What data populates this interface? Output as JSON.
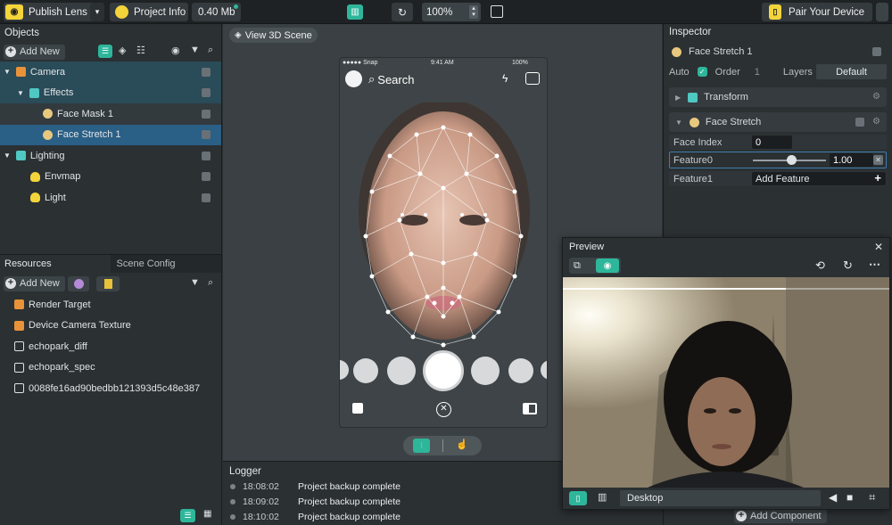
{
  "topbar": {
    "publish_label": "Publish Lens",
    "project_info_label": "Project Info",
    "size_label": "0.40 Mb",
    "zoom_value": "100%",
    "pair_device_label": "Pair Your Device"
  },
  "objects": {
    "title": "Objects",
    "add_new_label": "Add New",
    "items": [
      {
        "label": "Camera",
        "icon": "camera-icon"
      },
      {
        "label": "Effects",
        "icon": "effects-icon"
      },
      {
        "label": "Face Mask 1",
        "icon": "face-mask-icon"
      },
      {
        "label": "Face Stretch 1",
        "icon": "face-stretch-icon"
      },
      {
        "label": "Lighting",
        "icon": "lighting-icon"
      },
      {
        "label": "Envmap",
        "icon": "bulb-icon"
      },
      {
        "label": "Light",
        "icon": "bulb-icon"
      }
    ]
  },
  "resources": {
    "tab_resources": "Resources",
    "tab_scene_config": "Scene Config",
    "add_new_label": "Add New",
    "items": [
      {
        "label": "Render Target"
      },
      {
        "label": "Device Camera Texture"
      },
      {
        "label": "echopark_diff"
      },
      {
        "label": "echopark_spec"
      },
      {
        "label": "0088fe16ad90bedbb121393d5c48e387"
      }
    ]
  },
  "scene": {
    "view_3d_label": "View 3D Scene",
    "phone_carrier": "●●●●● Snap",
    "phone_time": "9:41 AM",
    "phone_battery": "100%",
    "search_label": "Search"
  },
  "logger": {
    "title": "Logger",
    "entries": [
      {
        "time": "18:08:02",
        "message": "Project backup complete"
      },
      {
        "time": "18:09:02",
        "message": "Project backup complete"
      },
      {
        "time": "18:10:02",
        "message": "Project backup complete"
      }
    ]
  },
  "inspector": {
    "title": "Inspector",
    "object_name": "Face Stretch 1",
    "auto_label": "Auto",
    "order_label": "Order",
    "order_value": "1",
    "layers_label": "Layers",
    "layers_value": "Default",
    "transform_label": "Transform",
    "face_stretch_label": "Face Stretch",
    "face_index_label": "Face Index",
    "face_index_value": "0",
    "feature0_label": "Feature0",
    "feature0_value": "1.00",
    "feature0_level": 0.52,
    "feature1_label": "Feature1",
    "add_feature_label": "Add Feature",
    "add_component_label": "Add Component"
  },
  "preview": {
    "title": "Preview",
    "device_value": "Desktop"
  },
  "colors": {
    "accent": "#2eb69b",
    "selection": "#2a5f86",
    "publish_yellow": "#f3d43a"
  }
}
